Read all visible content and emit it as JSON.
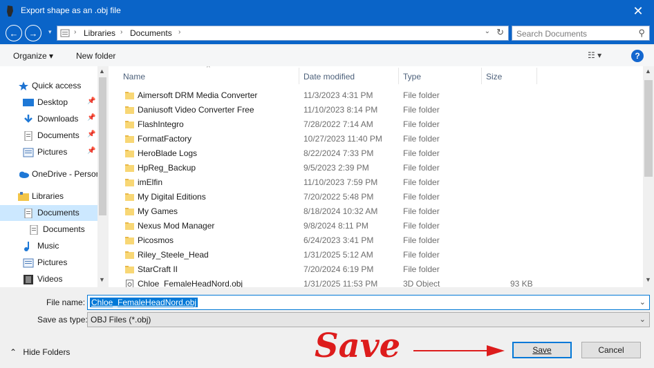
{
  "window": {
    "title": "Export shape as an .obj file",
    "close_glyph": "✕"
  },
  "nav": {
    "back_glyph": "←",
    "forward_glyph": "→",
    "recent_glyph": "▾",
    "address": {
      "crumbs": [
        "Libraries",
        "Documents"
      ],
      "sep_glyph": "›",
      "refresh_glyph": "↻",
      "dropdown_glyph": "⌄"
    },
    "search": {
      "placeholder": "Search Documents",
      "icon_glyph": "⚲"
    }
  },
  "toolbar": {
    "organize": "Organize ▾",
    "new_folder": "New folder",
    "views_glyph": "☷ ▾",
    "help": "?"
  },
  "sidebar": {
    "items": [
      {
        "label": "Quick access",
        "icon": "star-icon"
      },
      {
        "label": "Desktop",
        "icon": "desktop-icon",
        "pinned": true
      },
      {
        "label": "Downloads",
        "icon": "download-icon",
        "pinned": true
      },
      {
        "label": "Documents",
        "icon": "documents-icon",
        "pinned": true
      },
      {
        "label": "Pictures",
        "icon": "pictures-icon",
        "pinned": true
      },
      {
        "label": "OneDrive - Person",
        "icon": "cloud-icon"
      },
      {
        "label": "Libraries",
        "icon": "library-icon"
      },
      {
        "label": "Documents",
        "icon": "documents-icon",
        "selected": true
      },
      {
        "label": "Documents",
        "icon": "documents-icon"
      },
      {
        "label": "Music",
        "icon": "music-icon"
      },
      {
        "label": "Pictures",
        "icon": "pictures-icon"
      },
      {
        "label": "Videos",
        "icon": "videos-icon"
      }
    ],
    "pin_glyph": "📌"
  },
  "filelist": {
    "columns": {
      "name": "Name",
      "date": "Date modified",
      "type": "Type",
      "size": "Size"
    },
    "sort_glyph": "^",
    "rows": [
      {
        "name": "Aimersoft DRM Media Converter",
        "date": "11/3/2023 4:31 PM",
        "type": "File folder",
        "size": ""
      },
      {
        "name": "Daniusoft Video Converter Free",
        "date": "11/10/2023 8:14 PM",
        "type": "File folder",
        "size": ""
      },
      {
        "name": "FlashIntegro",
        "date": "7/28/2022 7:14 AM",
        "type": "File folder",
        "size": ""
      },
      {
        "name": "FormatFactory",
        "date": "10/27/2023 11:40 PM",
        "type": "File folder",
        "size": ""
      },
      {
        "name": "HeroBlade Logs",
        "date": "8/22/2024 7:33 PM",
        "type": "File folder",
        "size": ""
      },
      {
        "name": "HpReg_Backup",
        "date": "9/5/2023 2:39 PM",
        "type": "File folder",
        "size": ""
      },
      {
        "name": "imElfin",
        "date": "11/10/2023 7:59 PM",
        "type": "File folder",
        "size": ""
      },
      {
        "name": "My Digital Editions",
        "date": "7/20/2022 5:48 PM",
        "type": "File folder",
        "size": ""
      },
      {
        "name": "My Games",
        "date": "8/18/2024 10:32 AM",
        "type": "File folder",
        "size": ""
      },
      {
        "name": "Nexus Mod Manager",
        "date": "9/8/2024 8:11 PM",
        "type": "File folder",
        "size": ""
      },
      {
        "name": "Picosmos",
        "date": "6/24/2023 3:41 PM",
        "type": "File folder",
        "size": ""
      },
      {
        "name": "Riley_Steele_Head",
        "date": "1/31/2025 5:12 AM",
        "type": "File folder",
        "size": ""
      },
      {
        "name": "StarCraft II",
        "date": "7/20/2024 6:19 PM",
        "type": "File folder",
        "size": ""
      },
      {
        "name": "Chloe_FemaleHeadNord.obj",
        "date": "1/31/2025 11:53 PM",
        "type": "3D Object",
        "size": "93 KB"
      }
    ]
  },
  "form": {
    "file_name_label": "File name:",
    "file_name_value": "Chloe_FemaleHeadNord.obj",
    "save_type_label": "Save as type:",
    "save_type_value": "OBJ Files (*.obj)",
    "dropdown_glyph": "⌄"
  },
  "footer": {
    "hide_folders": "Hide Folders",
    "caret": "⌃",
    "save": "Save",
    "cancel": "Cancel"
  },
  "annotation": {
    "text": "Save"
  },
  "colors": {
    "accent": "#0a64c8",
    "selection": "#cce8ff",
    "annotation": "#dd1c1c",
    "folder": "#f8d775"
  }
}
